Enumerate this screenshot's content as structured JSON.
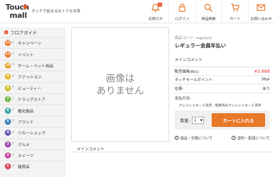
{
  "header": {
    "logo_line1": "Touch",
    "logo_line2": "mall",
    "tagline": "タッチで始まるおトクな本革",
    "nav": [
      {
        "label": "お知らせ",
        "icon": "bell-icon",
        "badge": "1"
      },
      {
        "label": "ログイン",
        "icon": "lock-icon"
      },
      {
        "label": "商品検索",
        "icon": "search-icon"
      },
      {
        "label": "カート",
        "icon": "cart-icon"
      },
      {
        "label": "お問い合わせ",
        "icon": "mail-icon"
      }
    ]
  },
  "sidebar": {
    "title": "フロアガイド",
    "items": [
      {
        "num": "12",
        "floor": "F",
        "label": "キャンペーン",
        "color": "#e8782a"
      },
      {
        "num": "11",
        "floor": "F",
        "label": "イベント",
        "color": "#e8782a"
      },
      {
        "num": "10",
        "floor": "F",
        "label": "ホーム・ペット用品",
        "color": "#e8a02a"
      },
      {
        "num": "9",
        "floor": "F",
        "label": "ファッション",
        "color": "#e8b82a"
      },
      {
        "num": "8",
        "floor": "F",
        "label": "ビューティー",
        "color": "#c6c02a"
      },
      {
        "num": "7",
        "floor": "F",
        "label": "ドラッグストア",
        "color": "#7cb84a"
      },
      {
        "num": "6",
        "floor": "F",
        "label": "電化製品",
        "color": "#3aa89a"
      },
      {
        "num": "5",
        "floor": "F",
        "label": "ブランド",
        "color": "#3a82c4"
      },
      {
        "num": "4",
        "floor": "F",
        "label": "リカーショップ",
        "color": "#6a5ab8"
      },
      {
        "num": "3",
        "floor": "F",
        "label": "グルメ",
        "color": "#9a4ab0"
      },
      {
        "num": "2",
        "floor": "F",
        "label": "スイーツ",
        "color": "#c84a9a"
      },
      {
        "num": "1",
        "floor": "F",
        "label": "雑貨品",
        "color": "#d84a5a"
      }
    ]
  },
  "product": {
    "no_image_line1": "画像は",
    "no_image_line2": "ありません",
    "code": "商品コード: regular2",
    "name": "レギュラー会員年払い",
    "main_comment": "メインコメント",
    "price_label": "販売価格",
    "price_tax": "(税込)",
    "price_value": "¥3,888",
    "points_label": "タッチモールポイント:",
    "points_value": "36pt",
    "stock_label": "在庫:",
    "stock_value": "あり",
    "payment_label": "支払方法:",
    "payment_methods": "クレジットカード決済、登録済みクレジットカード決済",
    "qty_label": "数量:",
    "qty_value": "1",
    "cart_button": "カートに入れる",
    "return_link": "返品・交換について",
    "shipping_link": "送料・配送について",
    "bottom_comment": "メインコメント"
  }
}
